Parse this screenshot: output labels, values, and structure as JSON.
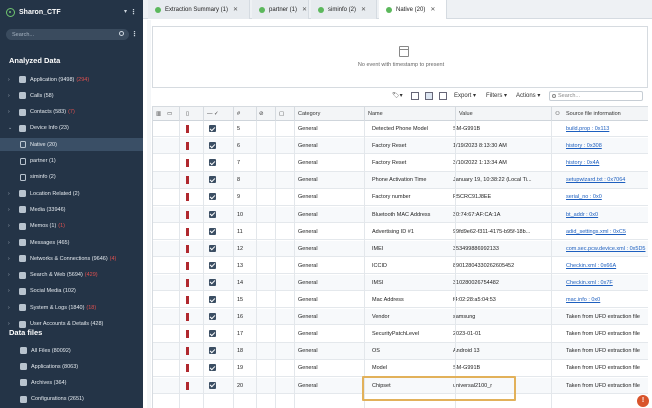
{
  "case": {
    "title": "Sharon_CTF"
  },
  "search": {
    "placeholder": "Search..."
  },
  "analyzed_title": "Analyzed Data",
  "datafiles_title": "Data files",
  "sidebar": [
    {
      "label": "Application (9498)",
      "extra": "(294)",
      "icon": "app-icon",
      "arrow": "›"
    },
    {
      "label": "Calls (58)",
      "extra": "",
      "icon": "phone-icon",
      "arrow": "›"
    },
    {
      "label": "Contacts (583)",
      "extra": "(7)",
      "icon": "contacts-icon",
      "arrow": "›"
    },
    {
      "label": "Device Info (23)",
      "extra": "",
      "icon": "device-icon",
      "arrow": "⌄"
    },
    {
      "label": "Native (20)",
      "extra": "",
      "icon": "doc-icon",
      "sub": true,
      "sel": true
    },
    {
      "label": "partner (1)",
      "extra": "",
      "icon": "doc-icon",
      "sub": true
    },
    {
      "label": "siminfo (2)",
      "extra": "",
      "icon": "doc-icon",
      "sub": true
    },
    {
      "label": "Location Related (2)",
      "extra": "",
      "icon": "location-icon",
      "arrow": "›"
    },
    {
      "label": "Media (33946)",
      "extra": "",
      "icon": "media-icon",
      "arrow": "›"
    },
    {
      "label": "Memos (1)",
      "extra": "(1)",
      "icon": "memo-icon",
      "arrow": "›"
    },
    {
      "label": "Messages (465)",
      "extra": "",
      "icon": "message-icon",
      "arrow": "›"
    },
    {
      "label": "Networks & Connections (9646)",
      "extra": "(4)",
      "icon": "network-icon",
      "arrow": "›"
    },
    {
      "label": "Search & Web (5694)",
      "extra": "(429)",
      "icon": "web-icon",
      "arrow": "›"
    },
    {
      "label": "Social Media (102)",
      "extra": "",
      "icon": "social-icon",
      "arrow": "›"
    },
    {
      "label": "System & Logs (1840)",
      "extra": "(18)",
      "icon": "logs-icon",
      "arrow": "›"
    },
    {
      "label": "User Accounts & Details (428)",
      "extra": "",
      "icon": "user-icon",
      "arrow": "›"
    }
  ],
  "files": [
    {
      "label": "All Files (80092)",
      "icon": "files-icon"
    },
    {
      "label": "Applications (8063)",
      "icon": "apps-icon"
    },
    {
      "label": "Archives (364)",
      "icon": "archive-icon"
    },
    {
      "label": "Configurations (2651)",
      "icon": "config-icon"
    }
  ],
  "tabs": [
    {
      "label": "Extraction Summary (1)",
      "active": false
    },
    {
      "label": "partner (1)",
      "active": false
    },
    {
      "label": "siminfo (2)",
      "active": false
    },
    {
      "label": "Native (20)",
      "active": true
    }
  ],
  "timeline_msg": "No event with timestamp to present",
  "toolbar": {
    "export": "Export ▾",
    "filters": "Filters ▾",
    "actions": "Actions ▾",
    "search_placeholder": "Search..."
  },
  "columns": {
    "num": "#",
    "category": "Category",
    "name": "Name",
    "value": "Value",
    "source": "Source file information"
  },
  "rows": [
    {
      "n": "5",
      "cat": "General",
      "name": "Detected Phone Model",
      "value": "SM-G991B",
      "src": "build.prop : 0x113",
      "link": true
    },
    {
      "n": "6",
      "cat": "General",
      "name": "Factory Reset",
      "value": "1/19/2023 8:13:30 AM",
      "src": "history : 0x308",
      "link": true
    },
    {
      "n": "7",
      "cat": "General",
      "name": "Factory Reset",
      "value": "3/10/2022 1:13:34 AM",
      "src": "history : 0x4A",
      "link": true
    },
    {
      "n": "8",
      "cat": "General",
      "name": "Phone Activation Time",
      "value": "January 19, 10:38:22 (Local Ti...",
      "src": "setupwizard.txt : 0x7064",
      "link": true
    },
    {
      "n": "9",
      "cat": "General",
      "name": "Factory number",
      "value": "R5CRC91J8EE",
      "src": "serial_no : 0x0",
      "link": true
    },
    {
      "n": "10",
      "cat": "General",
      "name": "Bluetooth MAC Address",
      "value": "30:74:67:AF:CA:1A",
      "src": "bt_addr : 0x0",
      "link": true
    },
    {
      "n": "11",
      "cat": "General",
      "name": "Advertising ID #1",
      "value": "99fd9e62-f311-4175-b95f-18b...",
      "src": "adid_settings.xml : 0xC5",
      "link": true
    },
    {
      "n": "12",
      "cat": "General",
      "name": "IMEI",
      "value": "353499886992133",
      "src": "com.sec.pcw.device.xml : 0x5D5",
      "link": true
    },
    {
      "n": "13",
      "cat": "General",
      "name": "ICCID",
      "value": "89012804330262605452",
      "src": "Checkin.xml : 0x66A",
      "link": true
    },
    {
      "n": "14",
      "cat": "General",
      "name": "IMSI",
      "value": "310280026754482",
      "src": "Checkin.xml : 0x7F",
      "link": true
    },
    {
      "n": "15",
      "cat": "General",
      "name": "Mac Address",
      "value": "f4:02:28:a5:04:53",
      "src": "mac.info : 0x0",
      "link": true
    },
    {
      "n": "16",
      "cat": "General",
      "name": "Vendor",
      "value": "samsung",
      "src": "Taken from UFD extraction file",
      "link": false
    },
    {
      "n": "17",
      "cat": "General",
      "name": "SecurityPatchLevel",
      "value": "2023-01-01",
      "src": "Taken from UFD extraction file",
      "link": false
    },
    {
      "n": "18",
      "cat": "General",
      "name": "OS",
      "value": "Android 13",
      "src": "Taken from UFD extraction file",
      "link": false
    },
    {
      "n": "19",
      "cat": "General",
      "name": "Model",
      "value": "SM-G991B",
      "src": "Taken from UFD extraction file",
      "link": false
    },
    {
      "n": "20",
      "cat": "General",
      "name": "Chipset",
      "value": "universal2100_r",
      "src": "Taken from UFD extraction file",
      "link": false
    }
  ],
  "notification_count": "!"
}
